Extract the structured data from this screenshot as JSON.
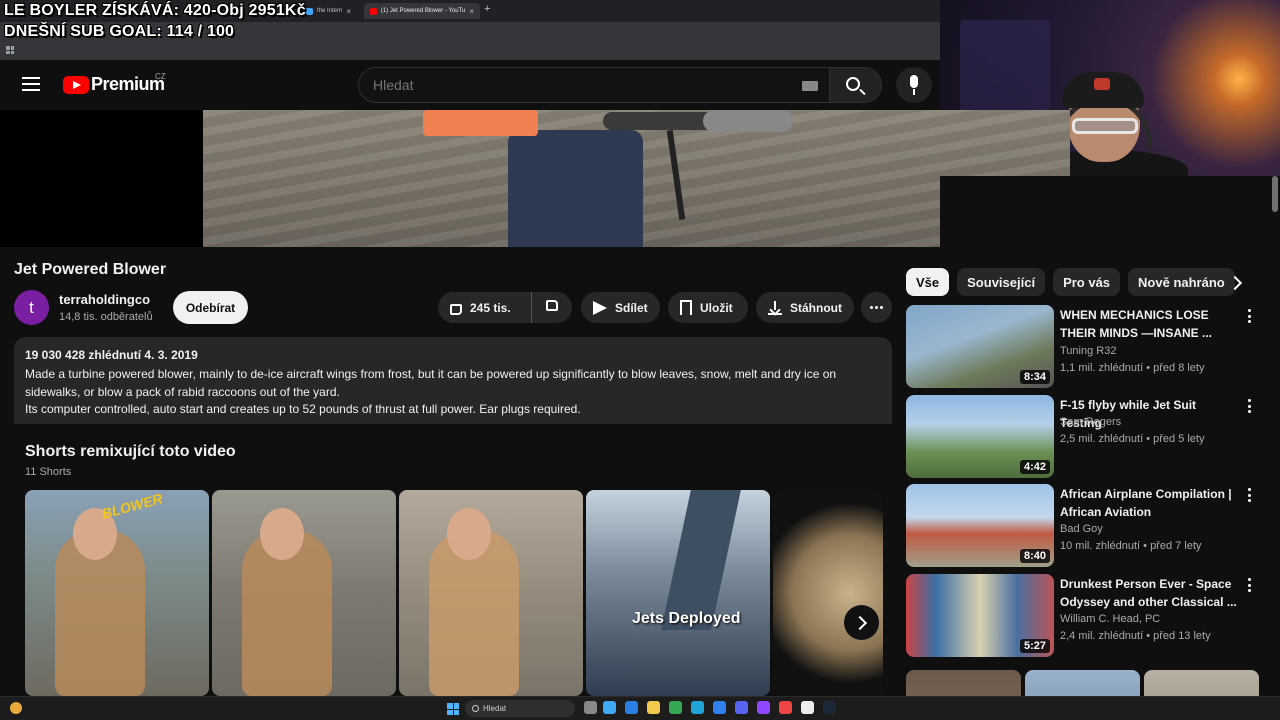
{
  "browser": {
    "tabs": [
      {
        "label": "the Intern",
        "active": false
      },
      {
        "label": "(1) Jet Powered Blower - YouTu",
        "active": true
      }
    ]
  },
  "stream_overlay": {
    "line1": "LE BOYLER ZÍSKÁVÁ: 420-Obj  2951Kč",
    "line2": "DNEŠNÍ SUB GOAL: 114 / 100"
  },
  "header": {
    "logo_text": "Premium",
    "region": "CZ",
    "search_placeholder": "Hledat",
    "icons": [
      "menu-icon",
      "keyboard-icon",
      "search-icon",
      "mic-icon"
    ]
  },
  "video": {
    "title": "Jet Powered Blower",
    "channel": {
      "avatar_letter": "t",
      "name": "terraholdingco",
      "subscribers": "14,8 tis. odběratelů",
      "subscribe_label": "Odebírat"
    },
    "actions": {
      "likes": "245 tis.",
      "share": "Sdílet",
      "save": "Uložit",
      "download": "Stáhnout"
    },
    "description": {
      "stats": "19 030 428 zhlédnutí  4. 3. 2019",
      "line1": "Made a turbine powered blower, mainly to de-ice aircraft wings from frost, but it can be powered up significantly to blow leaves, snow, melt and dry ice on sidewalks, or blow a pack of rabid raccoons out of the yard.",
      "line2": "Its computer controlled, auto start and creates up to 52 pounds of thrust at full power. Ear plugs required."
    },
    "shorts": {
      "title": "Shorts remixující toto video",
      "count": "11 Shorts",
      "captions": [
        "BLOWER",
        "Jets Deployed"
      ]
    }
  },
  "sidebar": {
    "chips": [
      {
        "label": "Vše",
        "selected": true
      },
      {
        "label": "Související",
        "selected": false
      },
      {
        "label": "Pro vás",
        "selected": false
      },
      {
        "label": "Nově nahráno",
        "selected": false
      }
    ],
    "recommendations": [
      {
        "title": "WHEN MECHANICS LOSE THEIR MINDS —INSANE ...",
        "channel": "Tuning R32",
        "meta": "1,1 mil. zhlédnutí • před 8 lety",
        "duration": "8:34"
      },
      {
        "title": "F-15 flyby while Jet Suit Testing",
        "channel": "Sam Rogers",
        "meta": "2,5 mil. zhlédnutí • před 5 lety",
        "duration": "4:42"
      },
      {
        "title": "African Airplane Compilation | African Aviation",
        "channel": "Bad Goy",
        "meta": "10 mil. zhlédnutí • před 7 lety",
        "duration": "8:40"
      },
      {
        "title": "Drunkest Person Ever - Space Odyssey and other Classical ...",
        "channel": "William C. Head, PC",
        "meta": "2,4 mil. zhlédnutí • před 13 lety",
        "duration": "5:27"
      }
    ]
  },
  "taskbar": {
    "search_placeholder": "Hledat"
  }
}
